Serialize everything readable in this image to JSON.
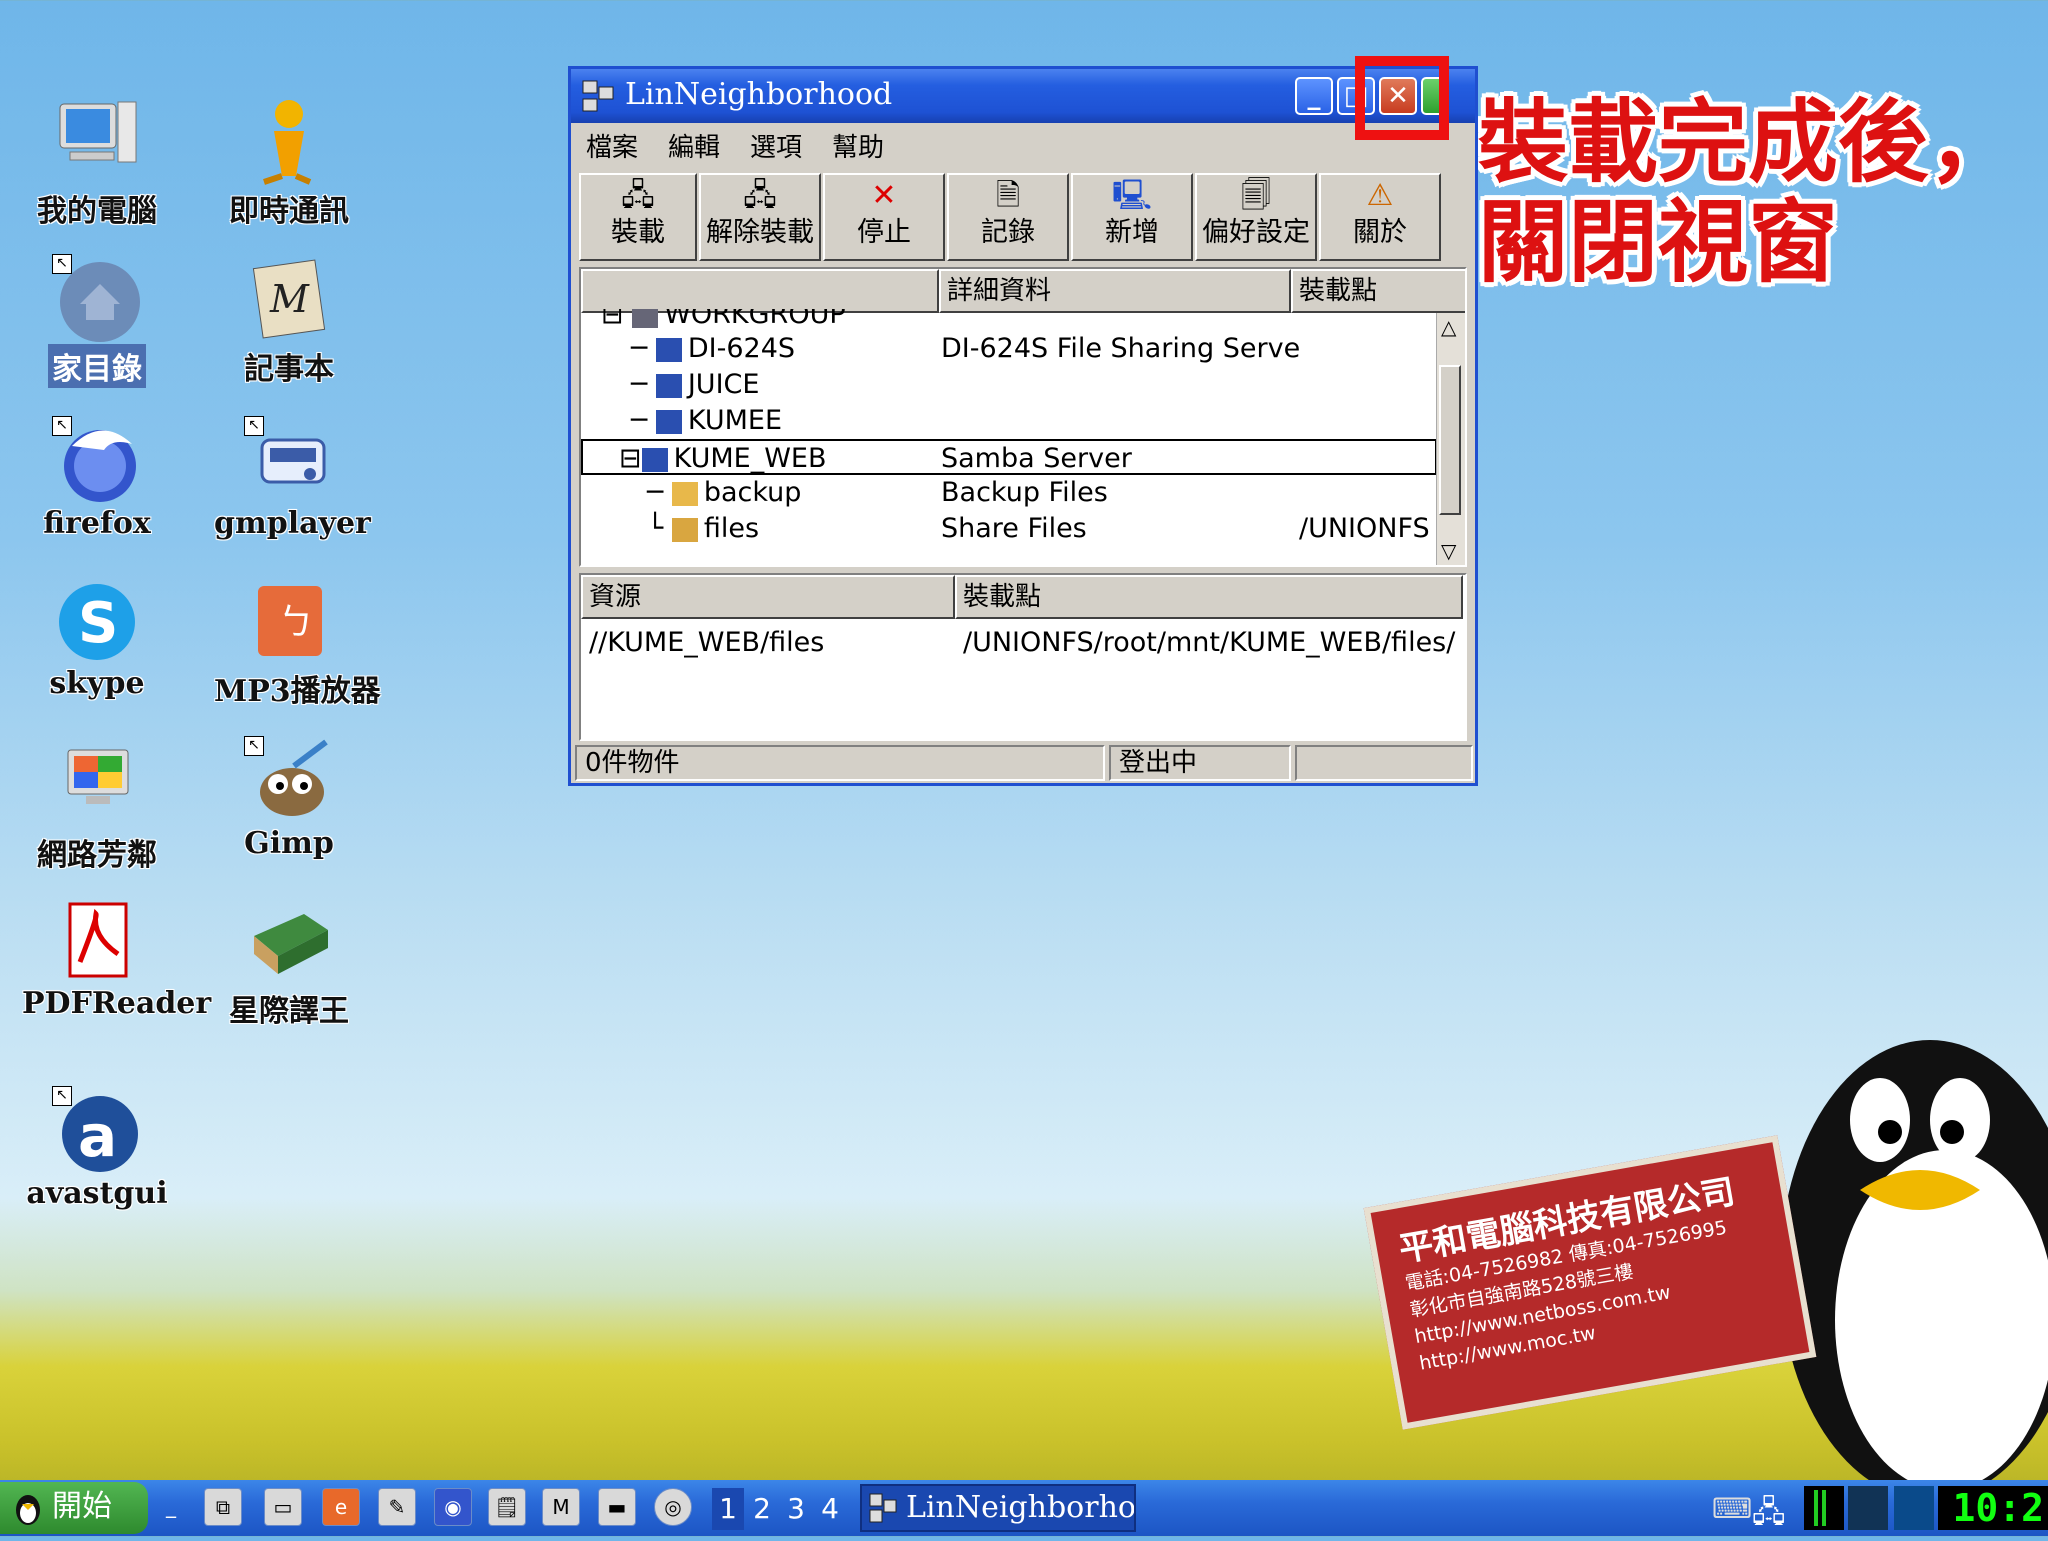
{
  "desktop": {
    "icons": [
      {
        "label": "我的電腦",
        "icon": "computer-icon"
      },
      {
        "label": "即時通訊",
        "icon": "messenger-icon"
      },
      {
        "label": "家目錄",
        "icon": "home-icon"
      },
      {
        "label": "記事本",
        "icon": "notepad-icon"
      },
      {
        "label": "firefox",
        "icon": "firefox-icon"
      },
      {
        "label": "gmplayer",
        "icon": "mplayer-icon"
      },
      {
        "label": "skype",
        "icon": "skype-icon"
      },
      {
        "label": "MP3播放器",
        "icon": "mp3-player-icon"
      },
      {
        "label": "網路芳鄰",
        "icon": "network-icon"
      },
      {
        "label": "Gimp",
        "icon": "gimp-icon"
      },
      {
        "label": "PDFReader",
        "icon": "pdf-icon"
      },
      {
        "label": "星際譯王",
        "icon": "dictionary-icon"
      },
      {
        "label": "avastgui",
        "icon": "avast-icon"
      }
    ]
  },
  "window": {
    "title": "LinNeighborhood",
    "menu": [
      "檔案",
      "編輯",
      "選項",
      "幫助"
    ],
    "toolbar": [
      {
        "label": "裝載",
        "icon": "mount-icon"
      },
      {
        "label": "解除裝載",
        "icon": "unmount-icon"
      },
      {
        "label": "停止",
        "icon": "stop-icon"
      },
      {
        "label": "記錄",
        "icon": "log-icon"
      },
      {
        "label": "新增",
        "icon": "add-icon"
      },
      {
        "label": "偏好設定",
        "icon": "preferences-icon"
      },
      {
        "label": "關於",
        "icon": "about-icon"
      }
    ],
    "tree_headers": [
      "",
      "詳細資料",
      "裝載點"
    ],
    "tree": [
      {
        "name": "WORKGROUP",
        "detail": "",
        "mount": ""
      },
      {
        "name": "DI-624S",
        "detail": "DI-624S File Sharing Serve",
        "mount": ""
      },
      {
        "name": "JUICE",
        "detail": "",
        "mount": ""
      },
      {
        "name": "KUMEE",
        "detail": "",
        "mount": ""
      },
      {
        "name": "KUME_WEB",
        "detail": "Samba Server",
        "mount": ""
      },
      {
        "name": "backup",
        "detail": "Backup Files",
        "mount": ""
      },
      {
        "name": "files",
        "detail": "Share Files",
        "mount": "/UNIONFS"
      }
    ],
    "mount_headers": [
      "資源",
      "裝載點"
    ],
    "mounts": [
      {
        "resource": "//KUME_WEB/files",
        "mount_point": "/UNIONFS/root/mnt/KUME_WEB/files/"
      }
    ],
    "status": {
      "items": "0件物件",
      "state": "登出中",
      "extra": ""
    }
  },
  "annotation": {
    "line1": "裝載完成後，",
    "line2": "關閉視窗",
    "color": "#d11111"
  },
  "sign": {
    "company": "平和電腦科技有限公司",
    "phone": "電話:04-7526982 傳真:04-7526995",
    "address": "彰化市自強南路528號三樓",
    "url1": "http://www.netboss.com.tw",
    "url2": "http://www.moc.tw"
  },
  "taskbar": {
    "start_label": "開始",
    "workspaces": [
      "1",
      "2",
      "3",
      "4"
    ],
    "task_label": "LinNeighborho...",
    "clock": "10:2"
  }
}
